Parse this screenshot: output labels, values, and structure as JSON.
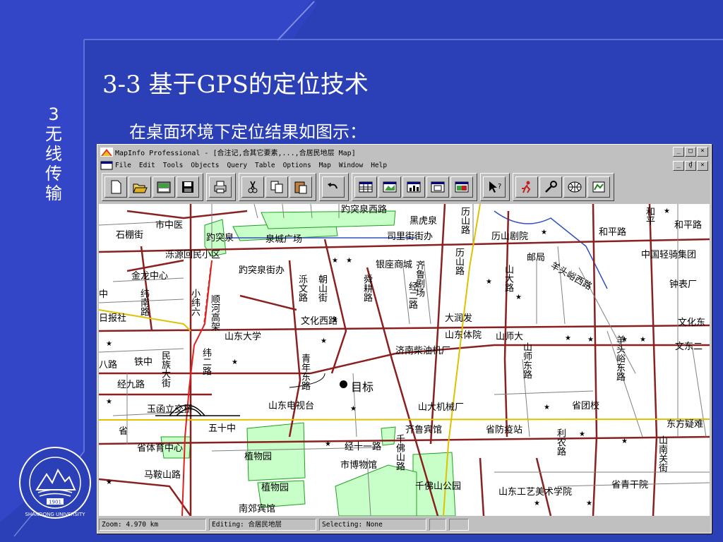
{
  "slide": {
    "vertical_title": "3无线传输",
    "title": "3-3 基于GPS的定位技术",
    "subtitle": "在桌面环境下定位结果如图示："
  },
  "window": {
    "title": "MapInfo Professional - [合注记,合其它要素,...,合居民地层 Map]",
    "buttons": [
      "_",
      "□",
      "×"
    ],
    "doc_buttons": [
      "_",
      "₫",
      "×"
    ]
  },
  "menu": [
    "File",
    "Edit",
    "Tools",
    "Objects",
    "Query",
    "Table",
    "Options",
    "Map",
    "Window",
    "Help"
  ],
  "toolbar_icons": [
    "new-icon",
    "open-icon",
    "open-workspace-icon",
    "save-icon",
    "print-icon",
    "cut-icon",
    "copy-icon",
    "paste-icon",
    "undo-icon",
    "new-browser-icon",
    "new-mapper-icon",
    "new-grapher-icon",
    "new-layout-icon",
    "redistricter-icon",
    "help-pointer-icon",
    "run-tool-icon",
    "tool-manager-icon",
    "world-icon",
    "map-window-icon"
  ],
  "map": {
    "target_label": "● 目标",
    "labels": [
      {
        "t": "趵突泉西路"
      },
      {
        "t": "黑虎泉"
      },
      {
        "t": "市中医"
      },
      {
        "t": "石棚街"
      },
      {
        "t": "趵突泉"
      },
      {
        "t": "泉城广场"
      },
      {
        "t": "司里街街办"
      },
      {
        "t": "历山剧院"
      },
      {
        "t": "和平路"
      },
      {
        "t": "和平路"
      },
      {
        "t": "泺源回民小区"
      },
      {
        "t": "银座商城"
      },
      {
        "t": "邮局"
      },
      {
        "t": "中国轻骑集团"
      },
      {
        "t": "趵突泉街办"
      },
      {
        "t": "金龙中心"
      },
      {
        "t": "钟表厂"
      },
      {
        "t": "日报社"
      },
      {
        "t": "文化西路"
      },
      {
        "t": "大润发"
      },
      {
        "t": "文化东"
      },
      {
        "t": "山东大学"
      },
      {
        "t": "山东体院"
      },
      {
        "t": "山师大"
      },
      {
        "t": "文东二"
      },
      {
        "t": "济南柴油机厂"
      },
      {
        "t": "八路"
      },
      {
        "t": "铁中"
      },
      {
        "t": "经九路"
      },
      {
        "t": "山东电视台"
      },
      {
        "t": "山大机械厂"
      },
      {
        "t": "省团校"
      },
      {
        "t": "五十中"
      },
      {
        "t": "齐鲁宾馆"
      },
      {
        "t": "省防疫站"
      },
      {
        "t": "东方疑难"
      },
      {
        "t": "省体育中心"
      },
      {
        "t": "经十一路"
      },
      {
        "t": "植物园"
      },
      {
        "t": "市博物馆"
      },
      {
        "t": "千佛山公园"
      },
      {
        "t": "植物园"
      },
      {
        "t": "山东工艺美术学院"
      },
      {
        "t": "省青干院"
      },
      {
        "t": "马鞍山路"
      },
      {
        "t": "南郊宾馆"
      },
      {
        "t": "玉函立交桥"
      },
      {
        "t": "省"
      },
      {
        "t": "历山路"
      },
      {
        "t": "山师东路"
      },
      {
        "t": "山大路"
      },
      {
        "t": "泺文路"
      },
      {
        "t": "朝山街"
      },
      {
        "t": "舜耕路"
      },
      {
        "t": "青年东路"
      },
      {
        "t": "纬二路"
      },
      {
        "t": "顺河高架"
      },
      {
        "t": "齐鲁剧场"
      },
      {
        "t": "羊头峪西路"
      },
      {
        "t": "羊头峪东路"
      },
      {
        "t": "千佛山路"
      },
      {
        "t": "利农路"
      },
      {
        "t": "纬南路"
      },
      {
        "t": "小纬六"
      },
      {
        "t": "经二路"
      },
      {
        "t": "山南关街"
      },
      {
        "t": "民族大街"
      },
      {
        "t": "历山路"
      },
      {
        "t": "和平"
      },
      {
        "t": "中"
      }
    ]
  },
  "status": {
    "zoom": "Zoom: 4.970 km",
    "editing": "Editing: 合居民地层",
    "selecting": "Selecting: None"
  }
}
